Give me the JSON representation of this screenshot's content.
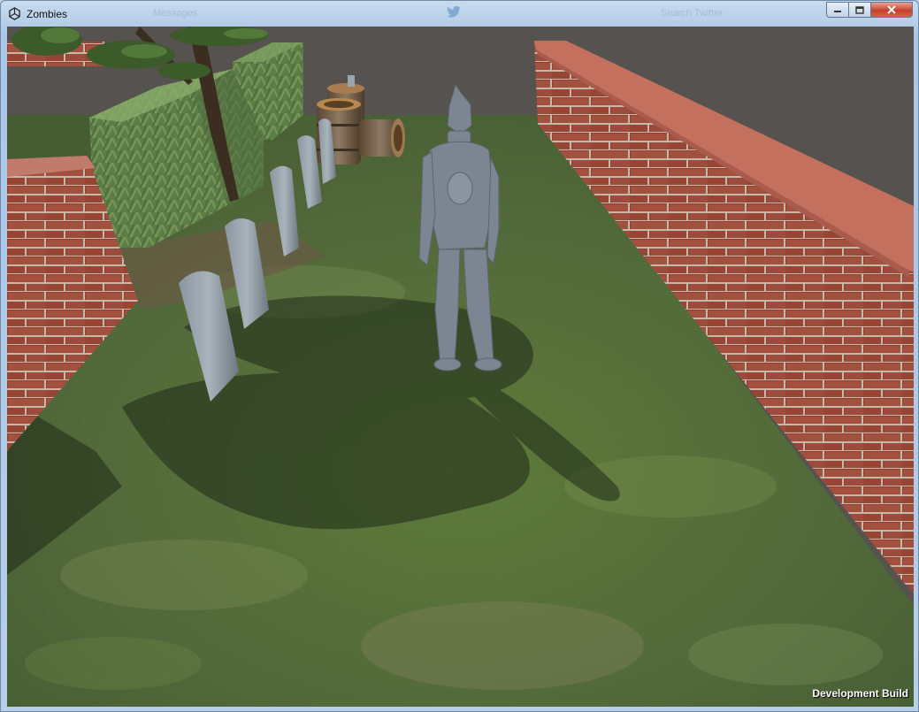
{
  "window": {
    "title": "Zombies",
    "ghost_texts": [
      "Messages",
      "Search Twitter"
    ]
  },
  "game": {
    "overlay_label": "Development Build",
    "scene_objects": [
      "brick-wall-right",
      "brick-wall-left",
      "hedge-block",
      "tree",
      "gravestone",
      "barrel",
      "player-character"
    ]
  },
  "colors": {
    "grass": "#56703a",
    "brick": "#9c4a3d",
    "wall_top": "#c86f5f",
    "sky": "#55524f"
  }
}
